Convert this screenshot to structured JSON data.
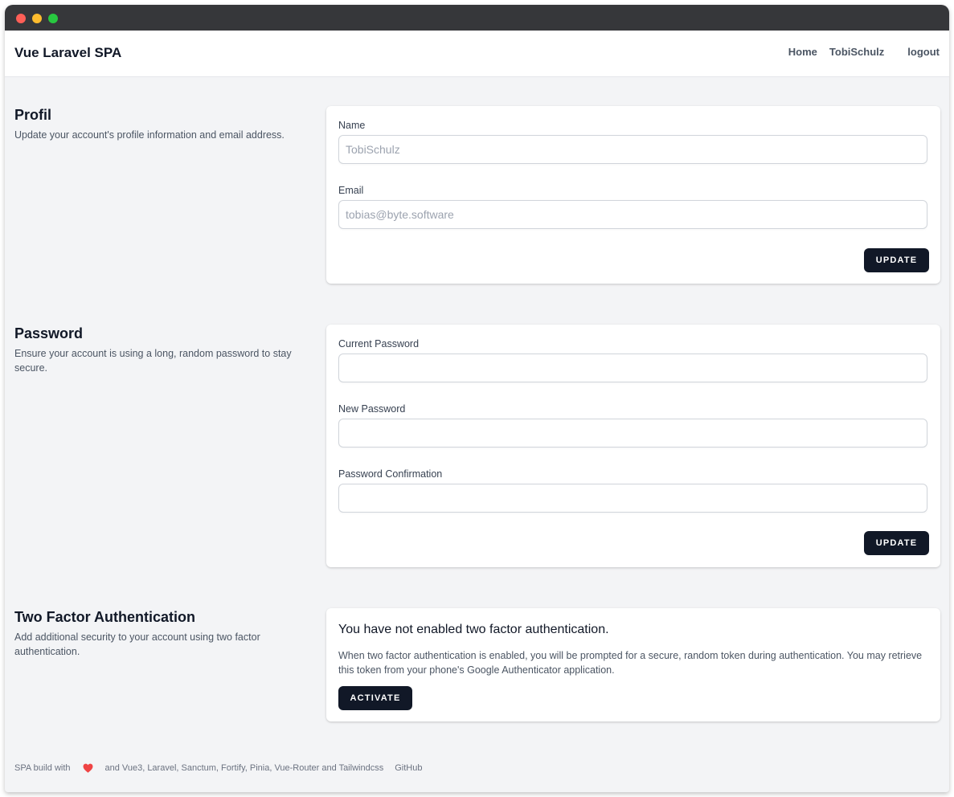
{
  "app": {
    "brand": "Vue Laravel SPA"
  },
  "nav": {
    "home": "Home",
    "user": "TobiSchulz",
    "logout": "logout"
  },
  "profile": {
    "title": "Profil",
    "description": "Update your account's profile information and email address.",
    "name_label": "Name",
    "name_placeholder": "TobiSchulz",
    "email_label": "Email",
    "email_placeholder": "tobias@byte.software",
    "update_label": "UPDATE"
  },
  "password": {
    "title": "Password",
    "description": "Ensure your account is using a long, random password to stay secure.",
    "current_label": "Current Password",
    "new_label": "New Password",
    "confirm_label": "Password Confirmation",
    "update_label": "UPDATE"
  },
  "two_factor": {
    "title": "Two Factor Authentication",
    "description": "Add additional security to your account using two factor authentication.",
    "heading": "You have not enabled two factor authentication.",
    "text": "When two factor authentication is enabled, you will be prompted for a secure, random token during authentication. You may retrieve this token from your phone's Google Authenticator application.",
    "activate_label": "ACTIVATE"
  },
  "footer": {
    "prefix": "SPA build with",
    "heart_icon": "heart-icon",
    "suffix": "and Vue3, Laravel, Sanctum, Fortify, Pinia, Vue-Router and Tailwindcss",
    "github": "GitHub"
  },
  "colors": {
    "primary_button": "#111827",
    "page_bg": "#f3f4f6",
    "heart": "#ef4444"
  }
}
